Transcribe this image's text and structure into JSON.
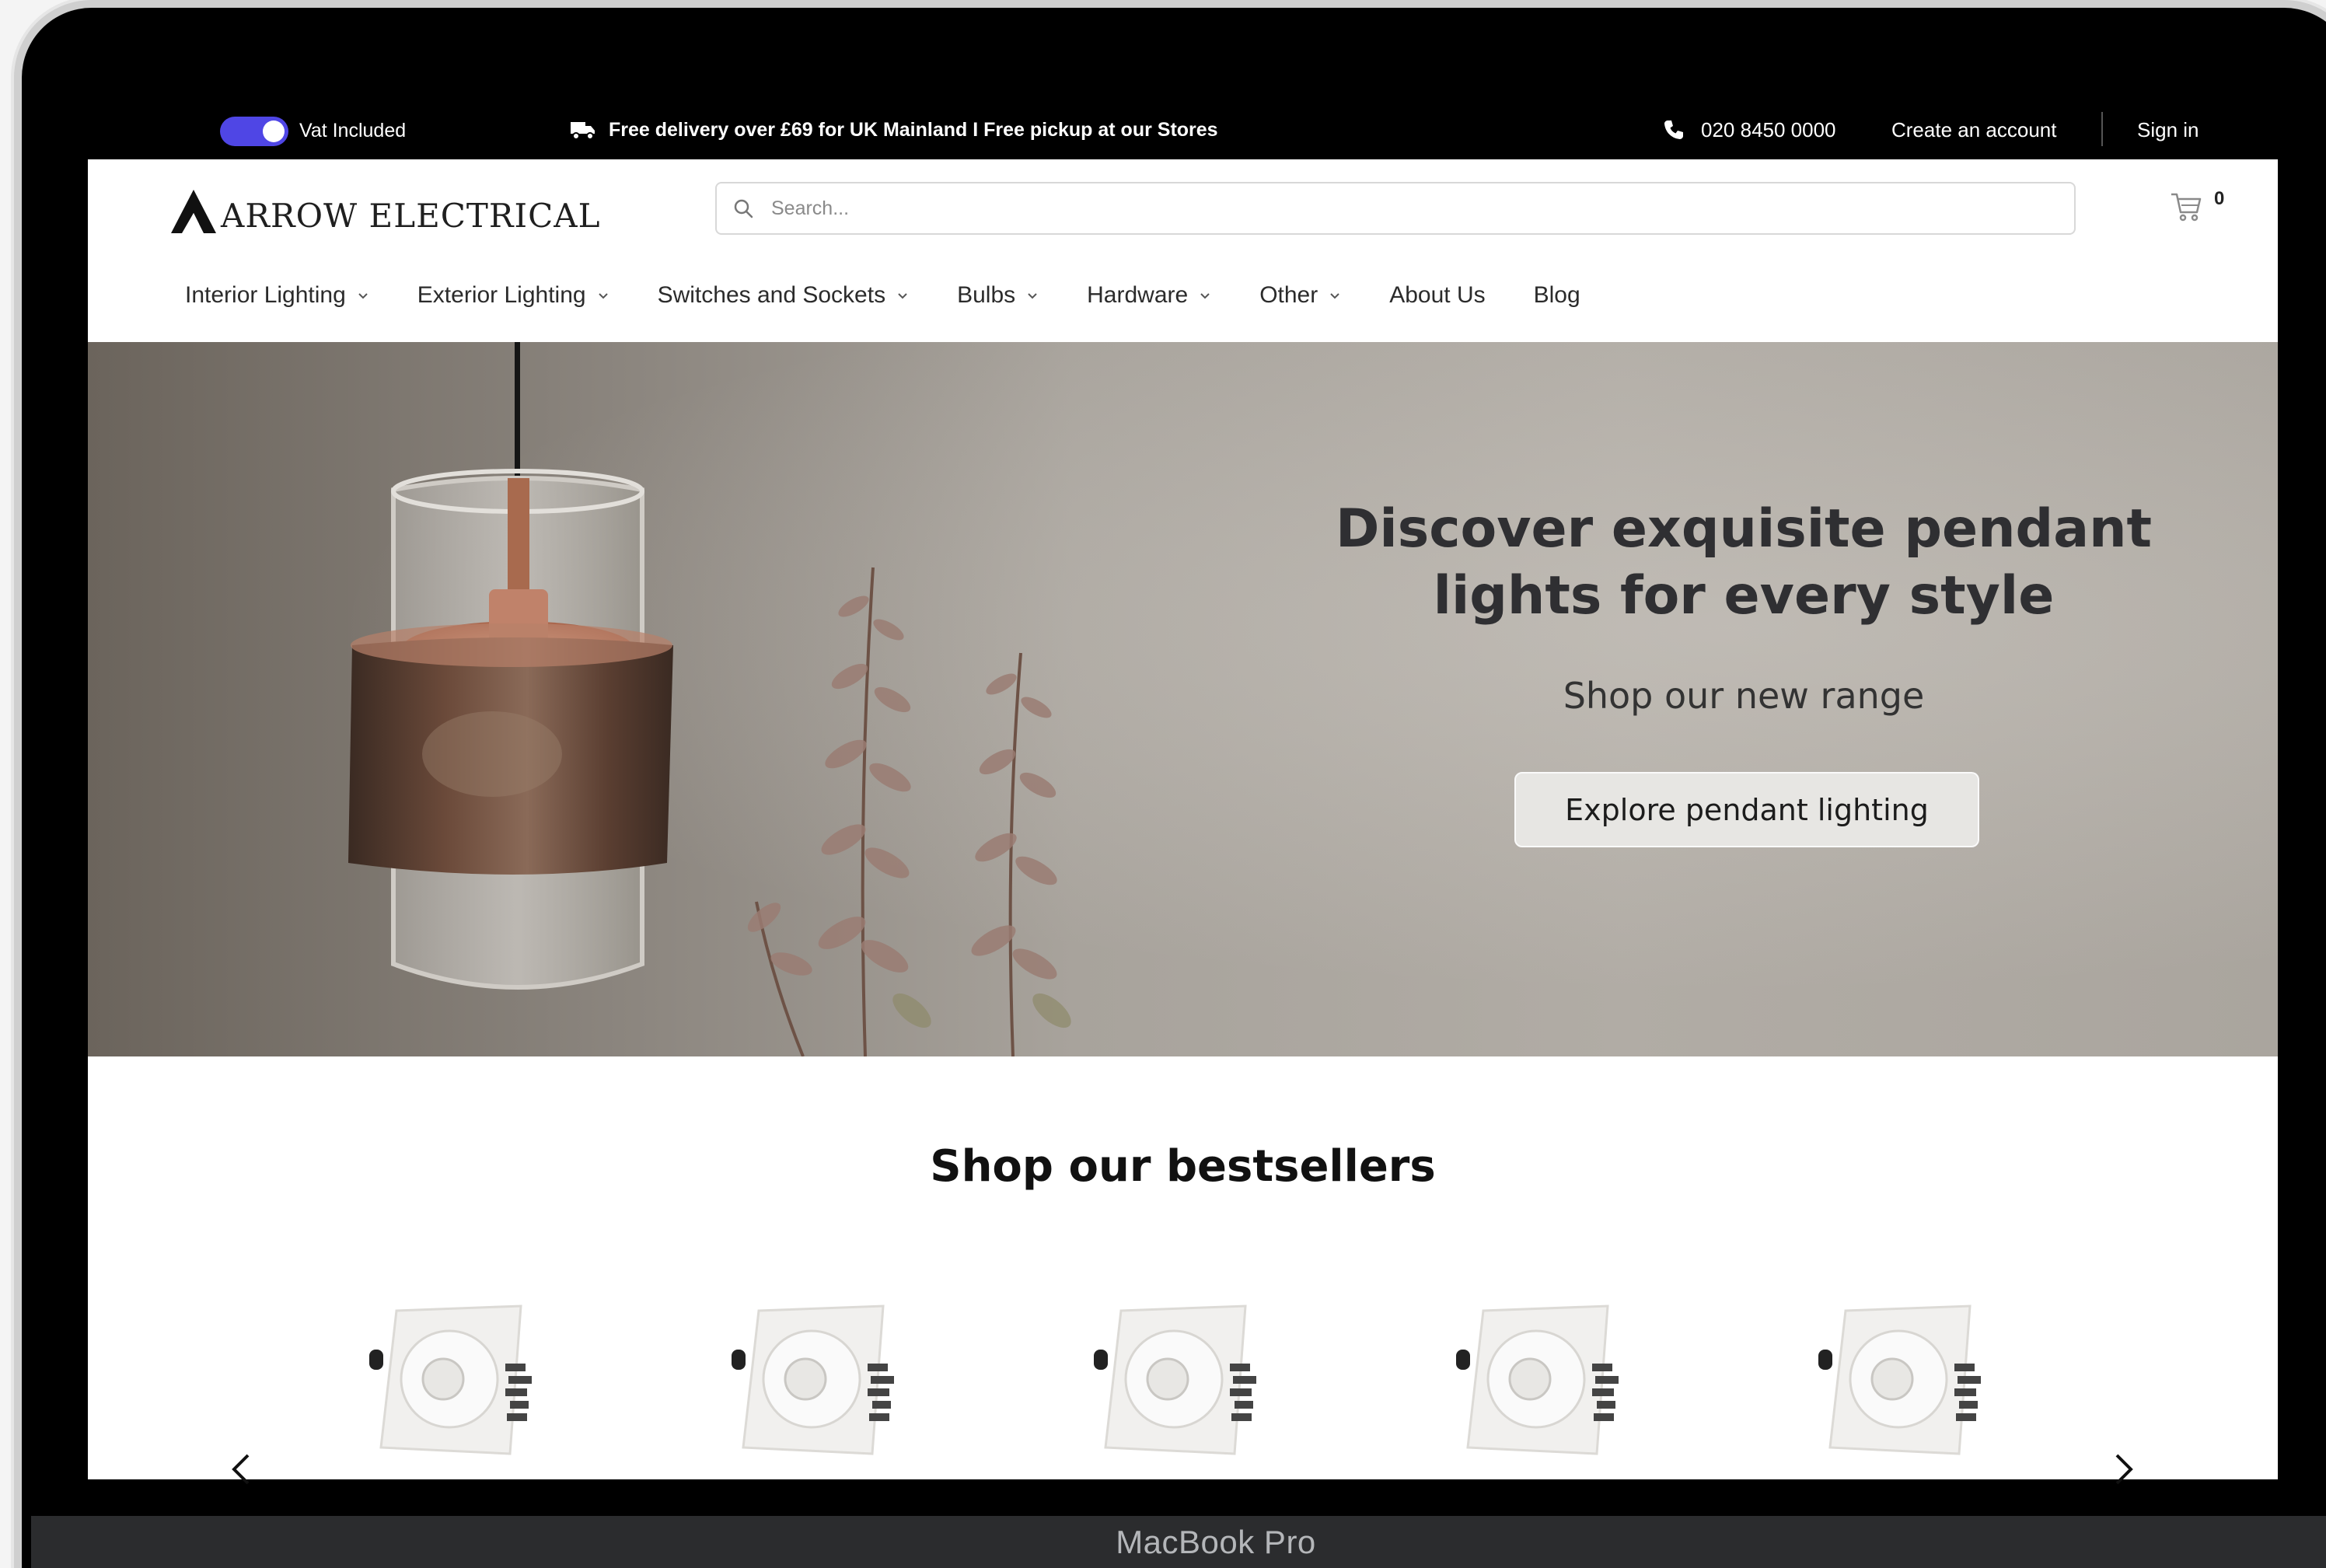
{
  "topbar": {
    "vat_label": "Vat Included",
    "vat_enabled": true,
    "promo": "Free delivery over £69 for UK Mainland I Free pickup at our Stores",
    "phone": "020 8450 0000",
    "create_account": "Create an account",
    "sign_in": "Sign in"
  },
  "header": {
    "logo_text": "ARROW ELECTRICAL",
    "search_placeholder": "Search...",
    "cart_count": "0"
  },
  "nav": [
    {
      "label": "Interior Lighting",
      "has_dropdown": true
    },
    {
      "label": "Exterior Lighting",
      "has_dropdown": true
    },
    {
      "label": "Switches and Sockets",
      "has_dropdown": true
    },
    {
      "label": "Bulbs",
      "has_dropdown": true
    },
    {
      "label": "Hardware",
      "has_dropdown": true
    },
    {
      "label": "Other",
      "has_dropdown": true
    },
    {
      "label": "About Us",
      "has_dropdown": false
    },
    {
      "label": "Blog",
      "has_dropdown": false
    }
  ],
  "hero": {
    "title": "Discover exquisite pendant lights for every style",
    "subtitle": "Shop our new range",
    "cta": "Explore pendant lighting"
  },
  "bestsellers": {
    "title": "Shop our bestsellers",
    "product_count": 5
  },
  "device": {
    "label": "MacBook Pro"
  },
  "colors": {
    "accent": "#4f46e5",
    "topbar_bg": "#000000",
    "text_dark": "#2f2f32"
  },
  "icons": [
    "truck-icon",
    "phone-icon",
    "search-icon",
    "cart-icon",
    "chevron-down-icon",
    "chevron-left-icon",
    "chevron-right-icon"
  ]
}
